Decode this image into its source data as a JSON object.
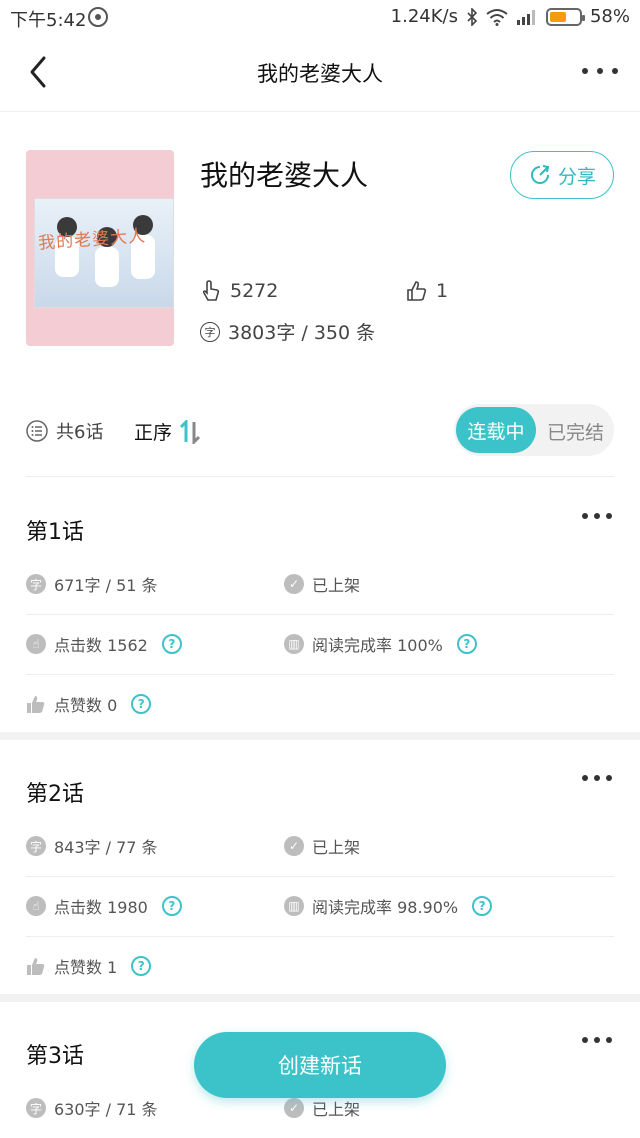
{
  "status": {
    "time": "下午5:42",
    "network_speed": "1.24K/s",
    "battery_pct": "58%",
    "battery_level": 0.58
  },
  "nav": {
    "title": "我的老婆大人",
    "back_icon": "chevron-left-icon",
    "more_icon": "more-horizontal-icon"
  },
  "book": {
    "cover_title": "我的老婆大人",
    "name": "我的老婆大人",
    "share_label": "分享",
    "clicks": "5272",
    "likes": "1",
    "words_comments": "3803字 / 350 条"
  },
  "filter": {
    "count": "共6话",
    "sort_label": "正序",
    "toggle_active": "连载中",
    "toggle_inactive": "已完结"
  },
  "chapters": [
    {
      "title": "第1话",
      "words": "671字 / 51 条",
      "status": "已上架",
      "clicks": "点击数 1562",
      "read_rate": "阅读完成率 100%",
      "likes": "点赞数 0"
    },
    {
      "title": "第2话",
      "words": "843字 / 77 条",
      "status": "已上架",
      "clicks": "点击数 1980",
      "read_rate": "阅读完成率 98.90%",
      "likes": "点赞数 1"
    },
    {
      "title": "第3话",
      "words": "630字 / 71 条",
      "status": "已上架"
    }
  ],
  "fab": {
    "label": "创建新话"
  },
  "colors": {
    "accent": "#3cc3c9",
    "cover_bg": "#f3cdd3"
  }
}
